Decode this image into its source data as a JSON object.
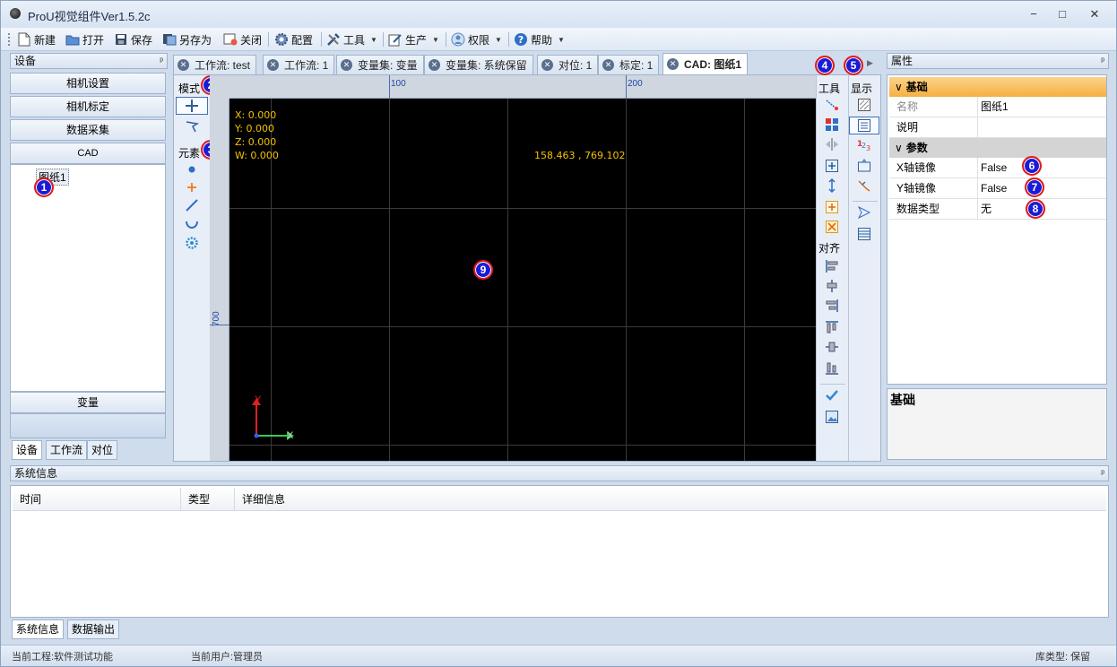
{
  "window": {
    "title": "ProU视觉组件Ver1.5.2c",
    "minimize": "−",
    "maximize": "□",
    "close": "✕"
  },
  "toolbar": {
    "new": "新建",
    "open": "打开",
    "save": "保存",
    "save_as": "另存为",
    "close": "关闭",
    "config": "配置",
    "tools": "工具",
    "production": "生产",
    "permission": "权限",
    "help": "帮助"
  },
  "left_panel": {
    "title": "设备",
    "nav": [
      "相机设置",
      "相机标定",
      "数据采集",
      "CAD"
    ],
    "tree_node": "图纸1",
    "variable": "变量",
    "tabs": [
      "设备",
      "工作流",
      "对位"
    ]
  },
  "doc_tabs": [
    "工作流: test",
    "工作流: 1",
    "变量集: 变量",
    "变量集: 系统保留",
    "对位: 1",
    "标定: 1",
    "CAD: 图纸1"
  ],
  "center": {
    "mode_label": "模式",
    "element_label": "元素",
    "tool_label": "工具",
    "display_label": "显示",
    "align_label": "对齐",
    "ruler_top": [
      "100",
      "200"
    ],
    "ruler_left": [
      "700"
    ],
    "readout": {
      "x": "X:   0.000",
      "y": "Y:   0.000",
      "z": "Z:   0.000",
      "w": "W:   0.000",
      "cursor": "158.463 , 769.102"
    },
    "axis_x": "X",
    "axis_y": "Y"
  },
  "properties": {
    "title": "属性",
    "cat_basic": "基础",
    "cat_params": "参数",
    "rows_basic": [
      {
        "name": "名称",
        "value": "图纸1"
      },
      {
        "name": "说明",
        "value": ""
      }
    ],
    "rows_params": [
      {
        "name": "X轴镜像",
        "value": "False"
      },
      {
        "name": "Y轴镜像",
        "value": "False"
      },
      {
        "name": "数据类型",
        "value": "无"
      }
    ],
    "description_title": "基础"
  },
  "sysinfo": {
    "title": "系统信息",
    "columns": [
      "时间",
      "类型",
      "详细信息"
    ],
    "tabs": [
      "系统信息",
      "数据输出"
    ]
  },
  "status": {
    "project": "当前工程:软件测试功能",
    "user": "当前用户:管理员",
    "db_type": "库类型: 保留"
  },
  "callouts": [
    "1",
    "2",
    "3",
    "4",
    "5",
    "6",
    "7",
    "8",
    "9"
  ],
  "colors": {
    "accent": "#f5b042",
    "callout_fill": "#1b1bd6",
    "callout_border": "#e01a1a",
    "readout": "#f2c200"
  }
}
